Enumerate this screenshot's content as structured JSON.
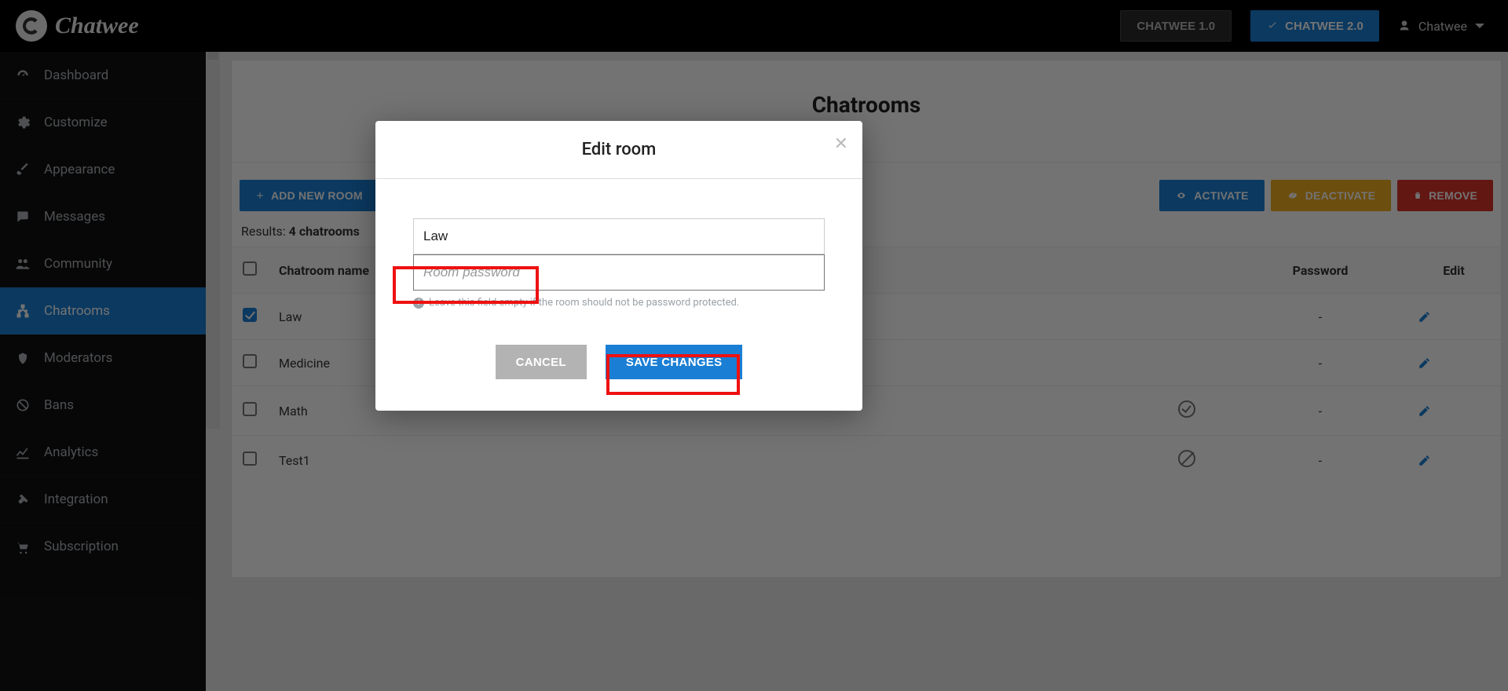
{
  "brand": "Chatwee",
  "topbar": {
    "version_old": "CHATWEE 1.0",
    "version_new": "CHATWEE 2.0",
    "user_name": "Chatwee"
  },
  "sidebar": {
    "items": [
      {
        "id": "dashboard",
        "label": "Dashboard"
      },
      {
        "id": "customize",
        "label": "Customize"
      },
      {
        "id": "appearance",
        "label": "Appearance"
      },
      {
        "id": "messages",
        "label": "Messages"
      },
      {
        "id": "community",
        "label": "Community"
      },
      {
        "id": "chatrooms",
        "label": "Chatrooms"
      },
      {
        "id": "moderators",
        "label": "Moderators"
      },
      {
        "id": "bans",
        "label": "Bans"
      },
      {
        "id": "analytics",
        "label": "Analytics"
      },
      {
        "id": "integration",
        "label": "Integration"
      },
      {
        "id": "subscription",
        "label": "Subscription"
      }
    ],
    "active": "chatrooms"
  },
  "page": {
    "title": "Chatrooms",
    "toolbar": {
      "add": "ADD NEW ROOM",
      "activate": "ACTIVATE",
      "deactivate": "DEACTIVATE",
      "remove": "REMOVE"
    },
    "results_prefix": "Results: ",
    "results_value": "4 chatrooms",
    "columns": {
      "name": "Chatroom name",
      "status": "",
      "password": "Password",
      "edit": "Edit"
    },
    "rows": [
      {
        "name": "Law",
        "checked": true,
        "status": "",
        "password": "-"
      },
      {
        "name": "Medicine",
        "checked": false,
        "status": "",
        "password": "-"
      },
      {
        "name": "Math",
        "checked": false,
        "status": "ok",
        "password": "-"
      },
      {
        "name": "Test1",
        "checked": false,
        "status": "off",
        "password": "-"
      }
    ]
  },
  "modal": {
    "title": "Edit room",
    "name_value": "Law",
    "password_value": "",
    "password_placeholder": "Room password",
    "hint": "Leave this field empty if the room should not be password protected.",
    "cancel": "CANCEL",
    "save": "SAVE CHANGES"
  },
  "colors": {
    "primary": "#1a7fd4",
    "amber": "#f0ad1f",
    "red": "#d9342a"
  }
}
